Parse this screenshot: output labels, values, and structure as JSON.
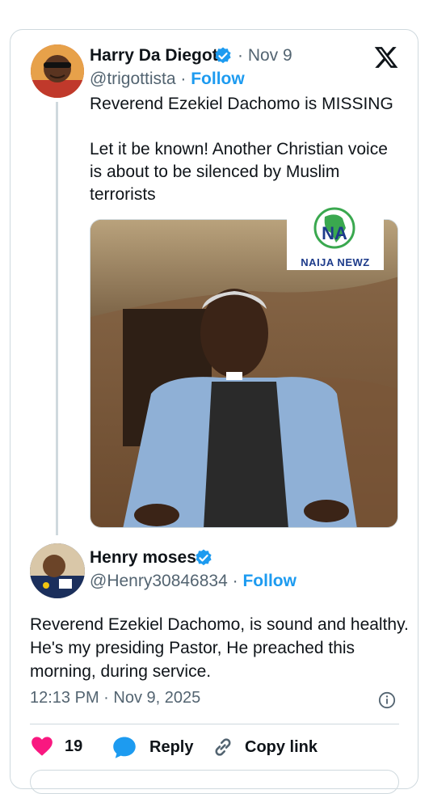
{
  "tweet": {
    "author_name": "Harry Da Diegot",
    "handle": "@trigottista",
    "date": "· Nov 9",
    "follow_label": "Follow",
    "text": "Reverend Ezekiel Dachomo is MISSING\n\nLet it be known! Another Christian voice is about to be silenced by Muslim terrorists",
    "image_watermark": "NAIJA NEWZ"
  },
  "reply": {
    "author_name": "Henry moses",
    "handle": "@Henry30846834",
    "follow_label": "Follow",
    "text": "Reverend Ezekiel Dachomo, is sound and healthy. He's my presiding Pastor, He preached this morning, during service.",
    "timestamp": "12:13 PM · Nov 9, 2025",
    "likes_count": "19",
    "reply_label": "Reply",
    "copy_link_label": "Copy link"
  },
  "colors": {
    "accent": "#1d9bf0",
    "like": "#f91880",
    "secondary_text": "#536471",
    "border": "#cfd9de"
  },
  "icons": [
    "verified-badge-icon",
    "x-logo-icon",
    "info-icon",
    "heart-icon",
    "reply-bubble-icon",
    "link-icon"
  ]
}
